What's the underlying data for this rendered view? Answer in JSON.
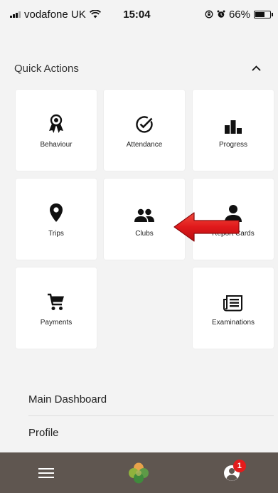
{
  "status": {
    "carrier": "vodafone UK",
    "time": "15:04",
    "battery": "66%"
  },
  "quick_actions": {
    "title": "Quick Actions",
    "tiles": [
      {
        "label": "Behaviour",
        "icon": "award-icon"
      },
      {
        "label": "Attendance",
        "icon": "check-circle-icon"
      },
      {
        "label": "Progress",
        "icon": "bar-chart-icon"
      },
      {
        "label": "Trips",
        "icon": "location-pin-icon"
      },
      {
        "label": "Clubs",
        "icon": "group-icon"
      },
      {
        "label": "Report Cards",
        "icon": "person-icon"
      },
      {
        "label": "Payments",
        "icon": "shopping-cart-icon"
      },
      {
        "label": "Examinations",
        "icon": "newspaper-icon"
      }
    ]
  },
  "menu": {
    "items": [
      {
        "label": "Main Dashboard"
      },
      {
        "label": "Profile"
      }
    ]
  },
  "bottom_nav": {
    "notification_count": "1"
  },
  "colors": {
    "background": "#f3f3f3",
    "tile": "#ffffff",
    "bottom_bar": "#5f5650",
    "badge": "#e21c1c",
    "arrow": "#e0191b"
  }
}
